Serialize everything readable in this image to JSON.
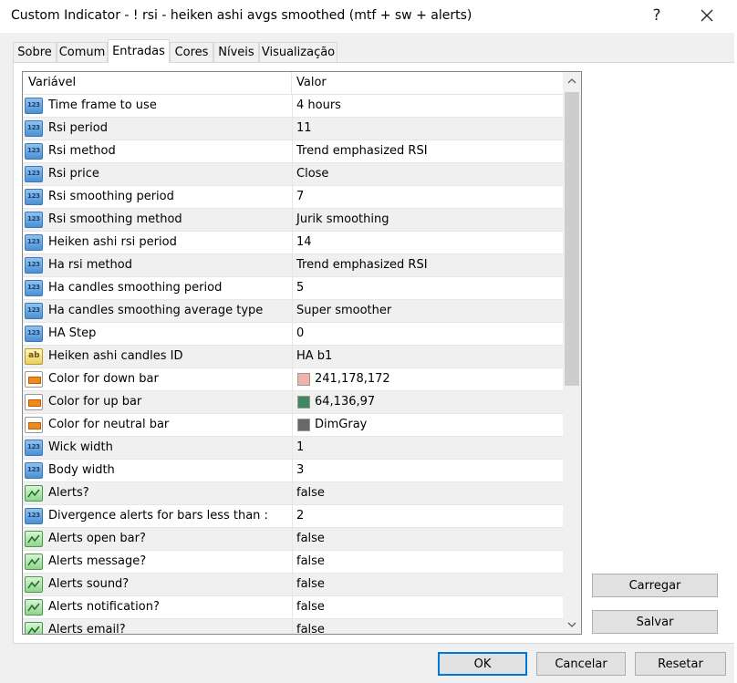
{
  "window": {
    "title": "Custom Indicator - ! rsi - heiken ashi avgs smoothed (mtf + sw + alerts)",
    "help_label": "?"
  },
  "tabs": [
    {
      "label": "Sobre",
      "active": false
    },
    {
      "label": "Comum",
      "active": false
    },
    {
      "label": "Entradas",
      "active": true
    },
    {
      "label": "Cores",
      "active": false
    },
    {
      "label": "Níveis",
      "active": false
    },
    {
      "label": "Visualização",
      "active": false
    }
  ],
  "table": {
    "headers": {
      "variable": "Variável",
      "value": "Valor"
    },
    "rows": [
      {
        "name": "Time frame to use",
        "value": "4 hours",
        "type": "number"
      },
      {
        "name": "Rsi period",
        "value": "11",
        "type": "number"
      },
      {
        "name": "Rsi method",
        "value": "Trend emphasized RSI",
        "type": "number"
      },
      {
        "name": "Rsi price",
        "value": "Close",
        "type": "number"
      },
      {
        "name": "Rsi smoothing period",
        "value": "7",
        "type": "number"
      },
      {
        "name": "Rsi smoothing method",
        "value": "Jurik smoothing",
        "type": "number"
      },
      {
        "name": "Heiken ashi rsi period",
        "value": "14",
        "type": "number"
      },
      {
        "name": "Ha rsi method",
        "value": "Trend emphasized RSI",
        "type": "number"
      },
      {
        "name": "Ha candles smoothing period",
        "value": "5",
        "type": "number"
      },
      {
        "name": "Ha candles smoothing average type",
        "value": "Super smoother",
        "type": "number"
      },
      {
        "name": "HA Step",
        "value": "0",
        "type": "number"
      },
      {
        "name": "Heiken ashi candles ID",
        "value": "HA b1",
        "type": "string"
      },
      {
        "name": "Color for down bar",
        "value": "241,178,172",
        "type": "color",
        "swatch": "#f1b2ac"
      },
      {
        "name": "Color for up bar",
        "value": "64,136,97",
        "type": "color",
        "swatch": "#408861"
      },
      {
        "name": "Color for neutral bar",
        "value": "DimGray",
        "type": "color",
        "swatch": "#696969"
      },
      {
        "name": "Wick width",
        "value": "1",
        "type": "number"
      },
      {
        "name": "Body width",
        "value": "3",
        "type": "number"
      },
      {
        "name": "Alerts?",
        "value": "false",
        "type": "bool"
      },
      {
        "name": "Divergence alerts for bars less than :",
        "value": "2",
        "type": "number"
      },
      {
        "name": "Alerts open bar?",
        "value": "false",
        "type": "bool"
      },
      {
        "name": "Alerts message?",
        "value": "false",
        "type": "bool"
      },
      {
        "name": "Alerts sound?",
        "value": "false",
        "type": "bool"
      },
      {
        "name": "Alerts notification?",
        "value": "false",
        "type": "bool"
      },
      {
        "name": "Alerts email?",
        "value": "false",
        "type": "bool"
      }
    ]
  },
  "side_buttons": {
    "load": "Carregar",
    "save": "Salvar"
  },
  "footer_buttons": {
    "ok": "OK",
    "cancel": "Cancelar",
    "reset": "Resetar"
  },
  "icon_glyphs": {
    "number": "123",
    "string": "ab"
  },
  "colors": {
    "accent": "#0078d7"
  }
}
